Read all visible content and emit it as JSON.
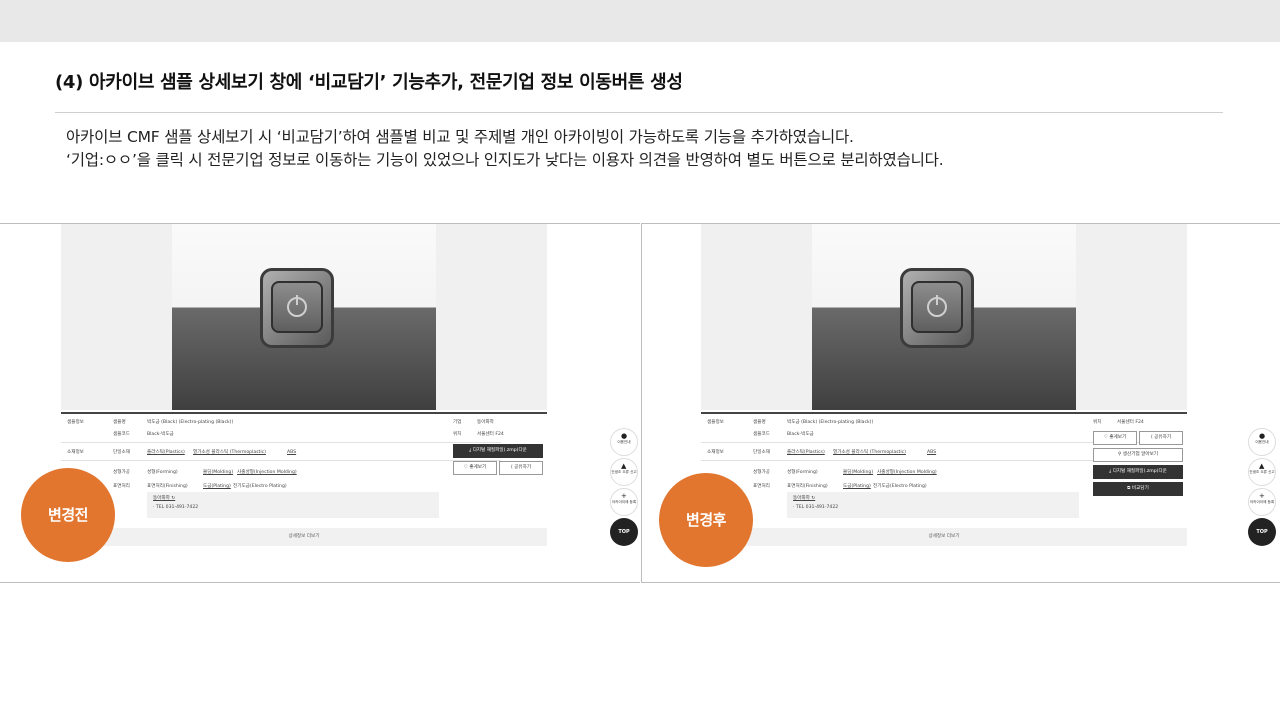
{
  "slide": {
    "title": "(4) 아카이브 샘플 상세보기 창에 ‘비교담기’ 기능추가, 전문기업 정보 이동버튼 생성",
    "desc_line1": "아카이브 CMF 샘플 상세보기 시 ‘비교담기’하여 샘플별 비교 및 주제별 개인 아카이빙이 가능하도록 기능을 추가하였습니다.",
    "desc_line2": "‘기업:ㅇㅇ’을 클릭 시 전문기업 정보로 이동하는 기능이 있었으나 인지도가 낮다는 이용자 의견을 반영하여 별도 버튼으로 분리하였습니다."
  },
  "before": {
    "badge": "변경전",
    "info": {
      "section1": "샘플정보",
      "k_name": "샘플명",
      "v_name": "박도금 (Black) (Electro-plating (Black))",
      "k_code": "샘플코드",
      "v_code": "Black-박도금",
      "section2": "소재정보",
      "k_material": "단일소재",
      "v_mat1": "플라스틱(Plastics)",
      "v_mat2": "열가소성 플라스틱 (Thermoplastic)",
      "v_mat3": "ABS",
      "section3": "공정정보",
      "k_forming": "성형가공",
      "v_form1": "성형(Forming)",
      "v_form2": "몰딩(Molding)",
      "v_form3": "사출성형(Injection Molding)",
      "k_finish": "표면처리",
      "v_fin1": "표면처리(Finishing)",
      "v_fin2": "도금(Plating)",
      "v_fin3": "전기도금(Electro Plating)",
      "company_link": "동아화학 ↻",
      "tel": "· TEL 031-491-7422",
      "k_company": "기업",
      "v_company": "동아화학",
      "k_location": "위치",
      "v_location": "서울센터 F24"
    },
    "buttons": {
      "download": "⤓ 디지털 재질파일(.zmp)다운",
      "like": "♡ 좋게보기",
      "share": "⟨ 공유하기"
    },
    "more": "상세정보 더보기"
  },
  "after": {
    "badge": "변경후",
    "info": {
      "k_location": "위치",
      "v_location": "서울센터 F24"
    },
    "buttons": {
      "like": "♡ 좋게보기",
      "share": "⟨ 공유하기",
      "company": "⚲ 생산기업 알아보기",
      "download": "⤓ 디지털 재질파일(.zmp)다운",
      "compare": "⧉ 비교담기"
    },
    "more": "상세정보 더보기"
  },
  "side": {
    "guide": "이용안내",
    "bug": "건생조 오류 신고",
    "archive": "아카이이에 등록",
    "top": "TOP"
  }
}
